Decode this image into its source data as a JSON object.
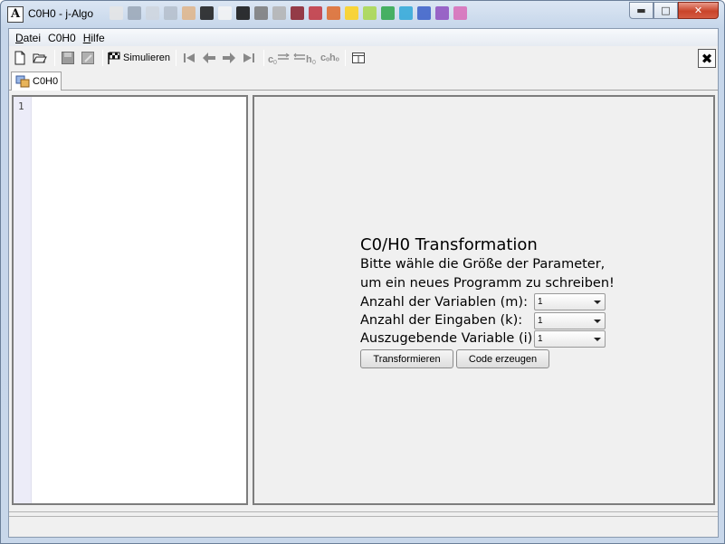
{
  "window": {
    "title": "C0H0  - j-Algo",
    "app_icon_letter": "A",
    "title_bg_colors": [
      "#e6e6e6",
      "#9aa7b7",
      "#cfd6df",
      "#b5bfcc",
      "#e0b58a",
      "#1a1a1a",
      "#f5f5f5",
      "#101010",
      "#7a7a7a",
      "#b3b3b3",
      "#8a1f2a",
      "#c3343e",
      "#e06a2a",
      "#ffd21a",
      "#a9d84c",
      "#2ea84b",
      "#2fa8d9",
      "#3a5fc9",
      "#8f4fc0",
      "#d96bb8"
    ]
  },
  "menubar": {
    "items": [
      {
        "label": "Datei",
        "mnemonic": "D"
      },
      {
        "label": "C0H0",
        "mnemonic": ""
      },
      {
        "label": "Hilfe",
        "mnemonic": "H"
      }
    ]
  },
  "toolbar": {
    "simulate_label": "Simulieren",
    "c0_h0_label": "c₀h₀"
  },
  "tabs": [
    {
      "label": "C0H0",
      "active": true
    }
  ],
  "editor": {
    "line_numbers": [
      "1"
    ]
  },
  "form": {
    "title": "C0/H0 Transformation",
    "line1": "Bitte wähle die Größe der Parameter,",
    "line2": "um ein neues Programm zu schreiben!",
    "fields": [
      {
        "label": "Anzahl der Variablen (m):",
        "value": "1"
      },
      {
        "label": "Anzahl der Eingaben (k):",
        "value": "1"
      },
      {
        "label": "Auszugebende Variable (i):",
        "value": "1"
      }
    ],
    "transform_button": "Transformieren",
    "code_button": "Code erzeugen"
  }
}
